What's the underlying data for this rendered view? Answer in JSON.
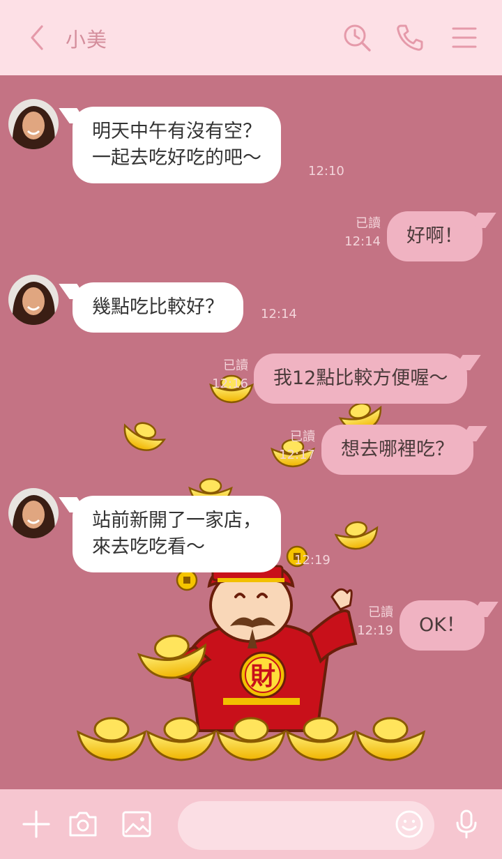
{
  "header": {
    "title": "小美",
    "icons": [
      "back-chevron-icon",
      "search-clock-icon",
      "phone-icon",
      "menu-icon"
    ]
  },
  "messages": [
    {
      "side": "in",
      "text": "明天中午有沒有空？\n一起去吃好吃的吧～",
      "time": "12:10"
    },
    {
      "side": "out",
      "text": "好啊！",
      "time": "12:14",
      "read": "已讀"
    },
    {
      "side": "in",
      "text": "幾點吃比較好？",
      "time": "12:14"
    },
    {
      "side": "out",
      "text": "我12點比較方便喔～",
      "time": "12:16",
      "read": "已讀"
    },
    {
      "side": "out",
      "text": "想去哪裡吃？",
      "time": "12:17",
      "read": "已讀"
    },
    {
      "side": "in",
      "text": "站前新開了一家店，\n來去吃吃看～",
      "time": "12:19"
    },
    {
      "side": "out",
      "text": "OK！",
      "time": "12:19",
      "read": "已讀"
    }
  ],
  "background_art": {
    "character_text": "財"
  },
  "footer": {
    "icons": [
      "plus-icon",
      "camera-icon",
      "image-icon",
      "emoji-icon",
      "microphone-icon"
    ],
    "input_placeholder": ""
  },
  "colors": {
    "chat_background": "#c47384",
    "header_background": "#fde0e6",
    "footer_background": "#f6c6d0",
    "outgoing_bubble": "#f0b3c2",
    "incoming_bubble": "#ffffff",
    "accent_icon": "#e59aaa"
  }
}
